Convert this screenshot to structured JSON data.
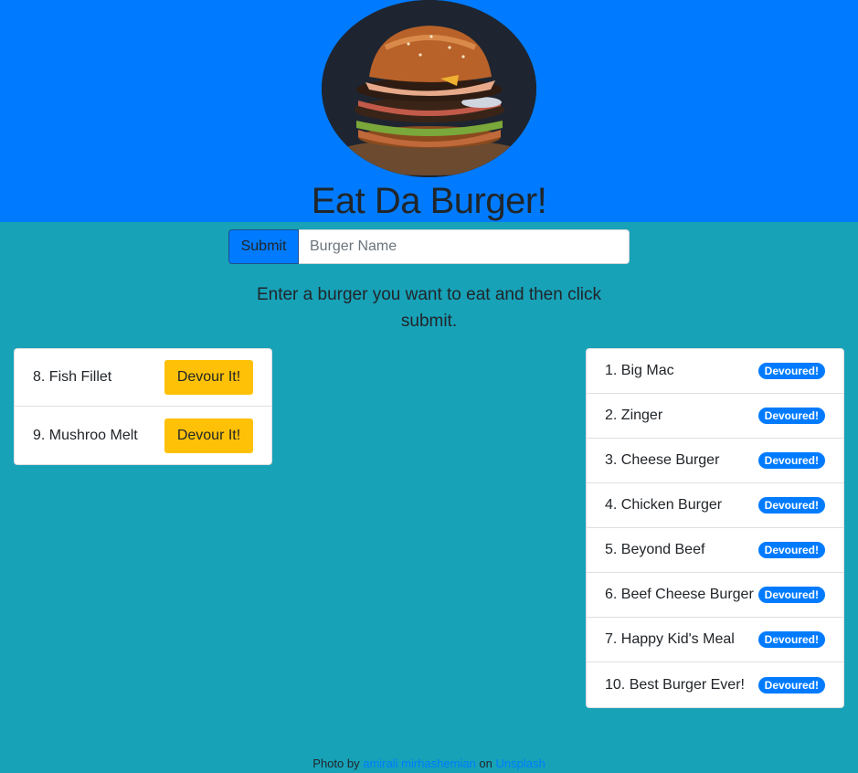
{
  "header": {
    "title": "Eat Da Burger!",
    "photo": "burger-photo"
  },
  "form": {
    "submit_label": "Submit",
    "placeholder": "Burger Name",
    "value": ""
  },
  "instructions": "Enter a burger you want to eat and then click submit.",
  "uneaten": [
    {
      "name": "8. Fish Fillet",
      "button": "Devour It!"
    },
    {
      "name": "9. Mushroo Melt",
      "button": "Devour It!"
    }
  ],
  "devoured": [
    {
      "name": "1. Big Mac",
      "badge": "Devoured!"
    },
    {
      "name": "2. Zinger",
      "badge": "Devoured!"
    },
    {
      "name": "3. Cheese Burger",
      "badge": "Devoured!"
    },
    {
      "name": "4. Chicken Burger",
      "badge": "Devoured!"
    },
    {
      "name": "5. Beyond Beef",
      "badge": "Devoured!"
    },
    {
      "name": "6. Beef Cheese Burger",
      "badge": "Devoured!"
    },
    {
      "name": "7. Happy Kid's Meal",
      "badge": "Devoured!"
    },
    {
      "name": "10. Best Burger Ever!",
      "badge": "Devoured!"
    }
  ],
  "footer": {
    "prefix": "Photo by",
    "author": "amirali mirhashemian",
    "middle": "on",
    "site": "Unsplash"
  },
  "colors": {
    "header_bg": "#007bff",
    "page_bg": "#17a2b8",
    "devour_button": "#ffc107",
    "badge": "#007bff"
  }
}
